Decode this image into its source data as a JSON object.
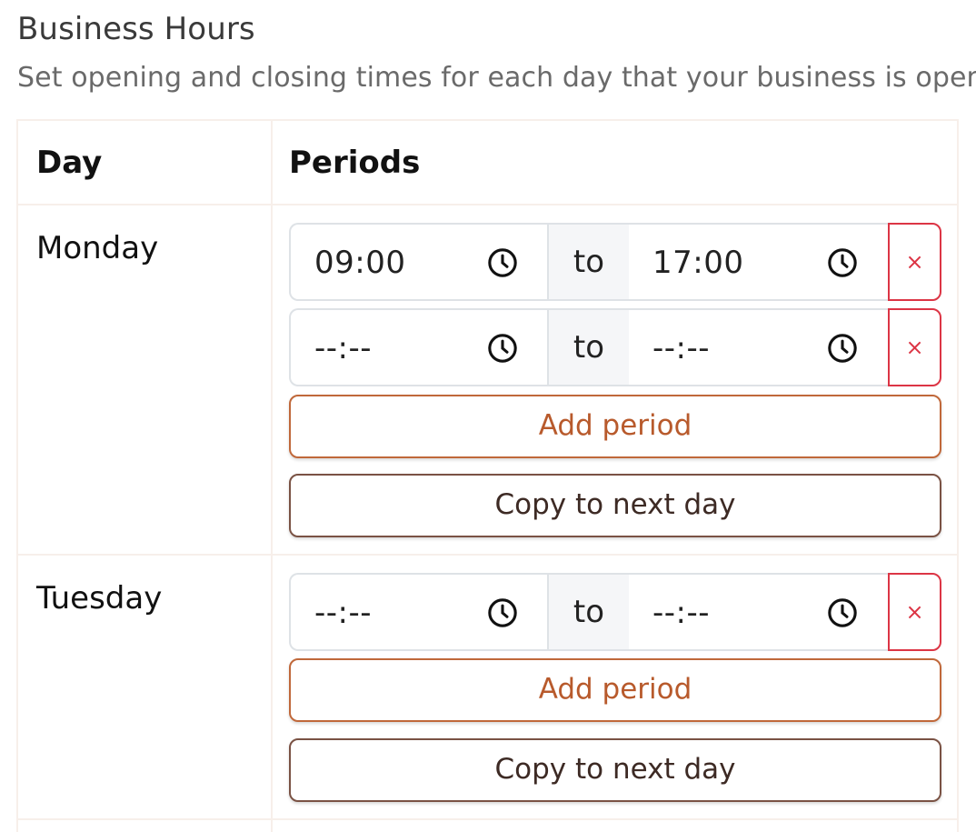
{
  "header": {
    "title": "Business Hours",
    "subtitle": "Set opening and closing times for each day that your business is open."
  },
  "table": {
    "col_day": "Day",
    "col_periods": "Periods",
    "to_label": "to",
    "remove_label": "×",
    "add_label": "Add period",
    "copy_label": "Copy to next day",
    "days": [
      {
        "name": "Monday",
        "periods": [
          {
            "start": "09:00",
            "end": "17:00"
          },
          {
            "start": "--:--",
            "end": "--:--"
          }
        ]
      },
      {
        "name": "Tuesday",
        "periods": [
          {
            "start": "--:--",
            "end": "--:--"
          }
        ]
      }
    ]
  },
  "colors": {
    "danger": "#dc3545",
    "accent": "#c0683a",
    "copy_border": "#7a5244"
  }
}
